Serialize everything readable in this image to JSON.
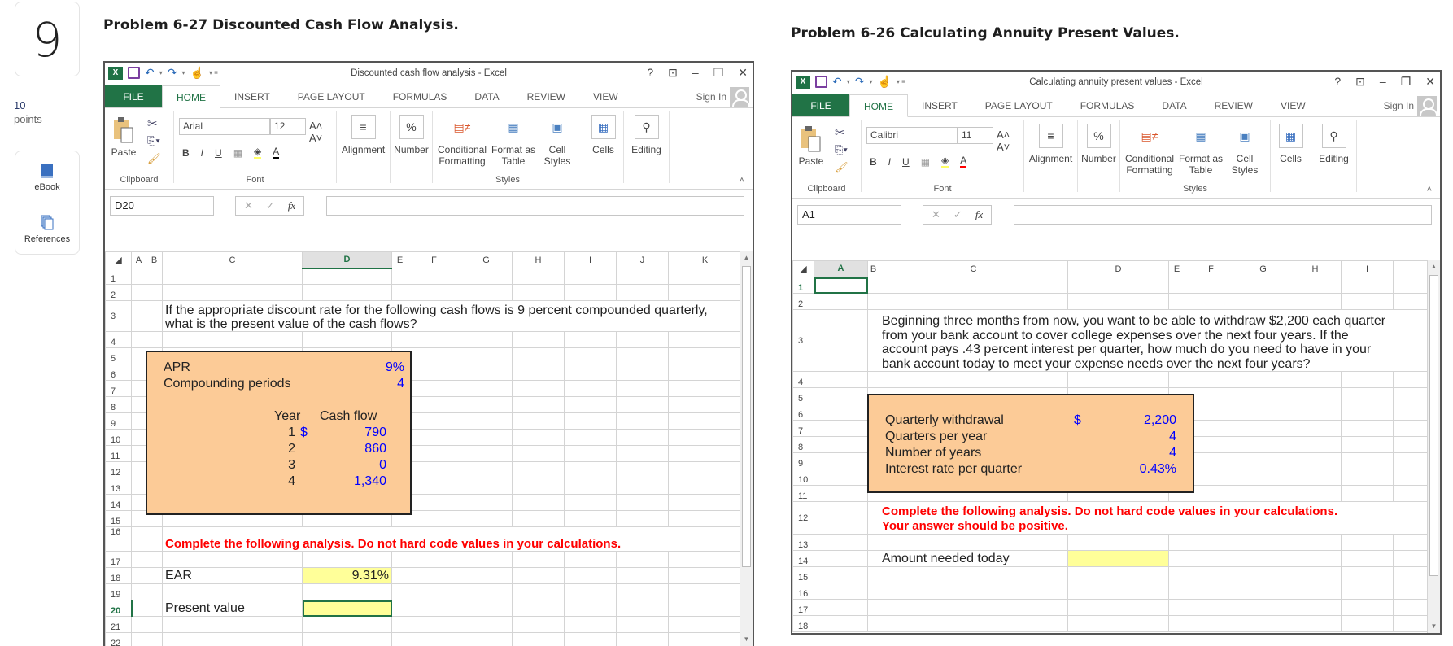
{
  "question": {
    "number": "9",
    "points_value": "10",
    "points_label": "points"
  },
  "side_tools": [
    {
      "label": "eBook",
      "icon": "book-icon"
    },
    {
      "label": "References",
      "icon": "references-icon"
    }
  ],
  "left_problem": {
    "heading": "Problem 6-27 Discounted Cash Flow Analysis.",
    "window_title": "Discounted cash flow analysis - Excel",
    "tabs": [
      "FILE",
      "HOME",
      "INSERT",
      "PAGE LAYOUT",
      "FORMULAS",
      "DATA",
      "REVIEW",
      "VIEW"
    ],
    "sign_in": "Sign In",
    "font_name": "Arial",
    "font_size": "12",
    "ribbon": {
      "paste": "Paste",
      "alignment": "Alignment",
      "number": "Number",
      "conditional": "Conditional Formatting",
      "format_table": "Format as Table",
      "cell_styles": "Cell Styles",
      "cells": "Cells",
      "editing": "Editing",
      "clipboard": "Clipboard",
      "font": "Font",
      "styles": "Styles"
    },
    "name_box": "D20",
    "formula": "",
    "columns": [
      "A",
      "B",
      "C",
      "D",
      "E",
      "F",
      "G",
      "H",
      "I",
      "J",
      "K"
    ],
    "selected_column": "D",
    "selected_row": "20",
    "question_text_1": "If the appropriate discount rate for the following cash flows is 9 percent compounded quarterly,",
    "question_text_2": "what is the present value of the cash flows?",
    "apr_label": "APR",
    "apr_value": "9%",
    "comp_label": "Compounding periods",
    "comp_value": "4",
    "year_header": "Year",
    "cf_header": "Cash flow",
    "cash_flows": [
      {
        "year": "1",
        "dollar": "$",
        "value": "790"
      },
      {
        "year": "2",
        "dollar": "",
        "value": "860"
      },
      {
        "year": "3",
        "dollar": "",
        "value": "0"
      },
      {
        "year": "4",
        "dollar": "",
        "value": "1,340"
      }
    ],
    "instruction": "Complete the following analysis. Do not hard code values in your calculations.",
    "ear_label": "EAR",
    "ear_value": "9.31%",
    "pv_label": "Present value",
    "pv_value": ""
  },
  "right_problem": {
    "heading": "Problem 6-26 Calculating Annuity Present Values.",
    "window_title": "Calculating annuity present values - Excel",
    "tabs": [
      "FILE",
      "HOME",
      "INSERT",
      "PAGE LAYOUT",
      "FORMULAS",
      "DATA",
      "REVIEW",
      "VIEW"
    ],
    "sign_in": "Sign In",
    "font_name": "Calibri",
    "font_size": "11",
    "name_box": "A1",
    "formula": "",
    "columns": [
      "A",
      "B",
      "C",
      "D",
      "E",
      "F",
      "G",
      "H",
      "I"
    ],
    "selected_column": "A",
    "selected_row": "1",
    "question_lines": [
      "Beginning three months from now, you want to be able to withdraw $2,200 each quarter",
      "from your bank account to cover college expenses over the next four years. If the",
      "account pays .43 percent interest per quarter, how much do you need to have in your",
      "bank account today to meet your expense needs over the next four years?"
    ],
    "inputs": [
      {
        "label": "Quarterly withdrawal",
        "dollar": "$",
        "value": "2,200"
      },
      {
        "label": "Quarters per year",
        "dollar": "",
        "value": "4"
      },
      {
        "label": "Number of years",
        "dollar": "",
        "value": "4"
      },
      {
        "label": "Interest rate per quarter",
        "dollar": "",
        "value": "0.43%"
      }
    ],
    "instruction_1": "Complete the following analysis. Do not hard code values in your calculations.",
    "instruction_2": "Your answer should be positive.",
    "amount_label": "Amount needed today",
    "amount_value": ""
  }
}
